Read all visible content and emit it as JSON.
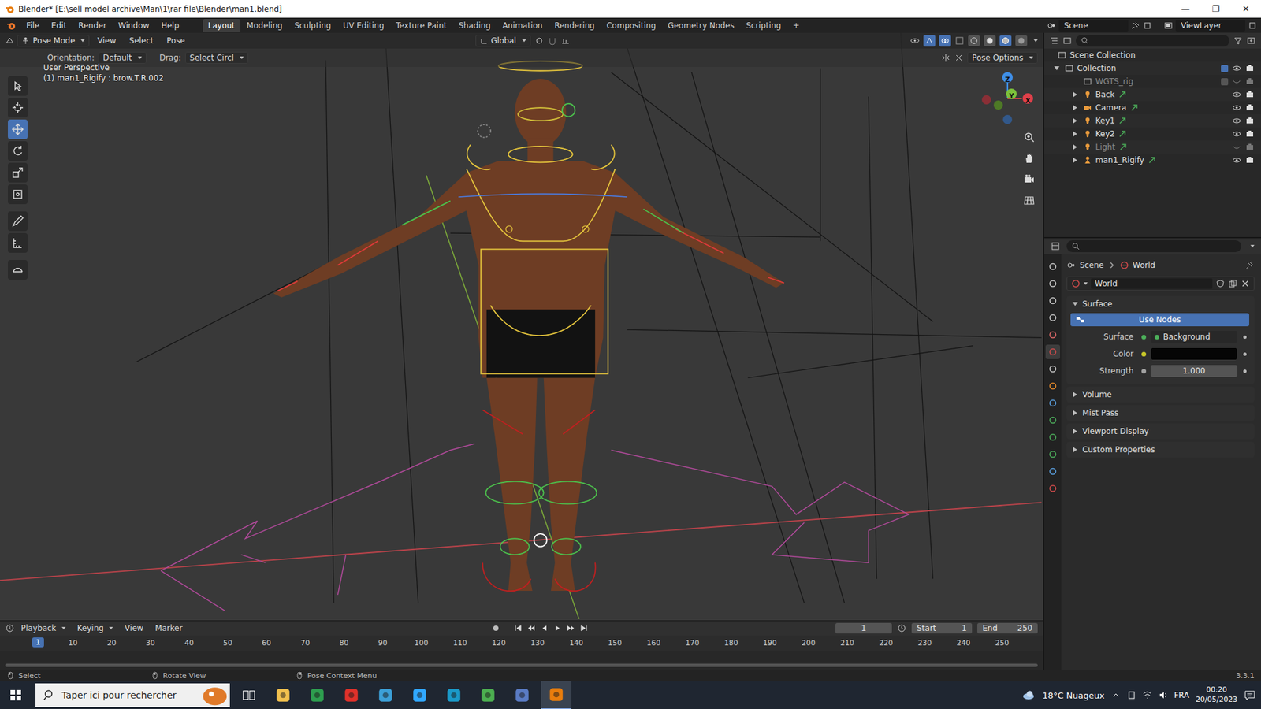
{
  "window": {
    "title": "Blender* [E:\\sell model archive\\Man\\1\\rar file\\Blender\\man1.blend]",
    "controls": [
      "—",
      "❐",
      "✕"
    ]
  },
  "menu": [
    "File",
    "Edit",
    "Render",
    "Window",
    "Help"
  ],
  "workspaces": [
    {
      "label": "Layout",
      "selected": true
    },
    {
      "label": "Modeling",
      "selected": false
    },
    {
      "label": "Sculpting",
      "selected": false
    },
    {
      "label": "UV Editing",
      "selected": false
    },
    {
      "label": "Texture Paint",
      "selected": false
    },
    {
      "label": "Shading",
      "selected": false
    },
    {
      "label": "Animation",
      "selected": false
    },
    {
      "label": "Rendering",
      "selected": false
    },
    {
      "label": "Compositing",
      "selected": false
    },
    {
      "label": "Geometry Nodes",
      "selected": false
    },
    {
      "label": "Scripting",
      "selected": false
    }
  ],
  "add_workspace": "+",
  "scene": "Scene",
  "view_layer": "ViewLayer",
  "viewport": {
    "mode": "Pose Mode",
    "menus": [
      "View",
      "Select",
      "Pose"
    ],
    "transform": "Global",
    "orientation_label": "Orientation:",
    "orientation": "Default",
    "drag_label": "Drag:",
    "drag": "Select Circl",
    "pose_options": "Pose Options",
    "perspective": "User Perspective",
    "active": "(1) man1_Rigify : brow.T.R.002",
    "axes": [
      "Z",
      "Y",
      "X"
    ],
    "shading_modes": [
      {
        "kind": "wireframe",
        "selected": false
      },
      {
        "kind": "solid",
        "selected": false
      },
      {
        "kind": "material",
        "selected": true
      },
      {
        "kind": "rendered",
        "selected": false
      }
    ]
  },
  "tools": [
    {
      "kind": "select",
      "selected": false
    },
    {
      "kind": "cursor",
      "selected": false
    },
    {
      "kind": "move",
      "selected": true
    },
    {
      "kind": "rotate",
      "selected": false
    },
    {
      "kind": "scale",
      "selected": false
    },
    {
      "kind": "transform",
      "selected": false
    },
    {
      "kind": "annotate",
      "selected": false
    },
    {
      "kind": "measure",
      "selected": false
    },
    {
      "kind": "relax",
      "selected": false
    }
  ],
  "outliner": {
    "root": "Scene Collection",
    "collection": "Collection",
    "collection_checked": true,
    "items": [
      {
        "name": "WGTS_rig",
        "kind": "collection",
        "checked": false,
        "visible": false,
        "expandable": false
      },
      {
        "name": "Back",
        "kind": "object",
        "visible": true,
        "expandable": true
      },
      {
        "name": "Camera",
        "kind": "camera",
        "visible": true,
        "expandable": true
      },
      {
        "name": "Key1",
        "kind": "object",
        "visible": true,
        "expandable": true
      },
      {
        "name": "Key2",
        "kind": "object",
        "visible": true,
        "expandable": true
      },
      {
        "name": "Light",
        "kind": "object",
        "visible": false,
        "expandable": true
      },
      {
        "name": "man1_Rigify",
        "kind": "armature",
        "visible": true,
        "expandable": true
      }
    ]
  },
  "properties": {
    "breadcrumb": [
      "Scene",
      "World"
    ],
    "world": "World",
    "surface_section": "Surface",
    "use_nodes": "Use Nodes",
    "fields": [
      {
        "label": "Surface",
        "value": "Background",
        "kind": "node"
      },
      {
        "label": "Color",
        "value": "",
        "kind": "color"
      },
      {
        "label": "Strength",
        "value": "1.000",
        "kind": "number"
      }
    ],
    "collapsed": [
      "Volume",
      "Mist Pass",
      "Viewport Display",
      "Custom Properties"
    ]
  },
  "timeline": {
    "menus": [
      "Playback",
      "Keying",
      "View",
      "Marker"
    ],
    "frame": "1",
    "start_label": "Start",
    "start": "1",
    "end_label": "End",
    "end": "250",
    "current": "1",
    "ticks": [
      "10",
      "20",
      "30",
      "40",
      "50",
      "60",
      "70",
      "80",
      "90",
      "100",
      "110",
      "120",
      "130",
      "140",
      "150",
      "160",
      "170",
      "180",
      "190",
      "200",
      "210",
      "220",
      "230",
      "240",
      "250"
    ]
  },
  "status": {
    "items": [
      "Select",
      "Rotate View",
      "Pose Context Menu"
    ],
    "version": "3.3.1"
  },
  "taskbar": {
    "search": "Taper ici pour rechercher",
    "weather": "18°C Nuageux",
    "lang": "FRA",
    "time": "00:20",
    "date": "20/05/2023"
  }
}
